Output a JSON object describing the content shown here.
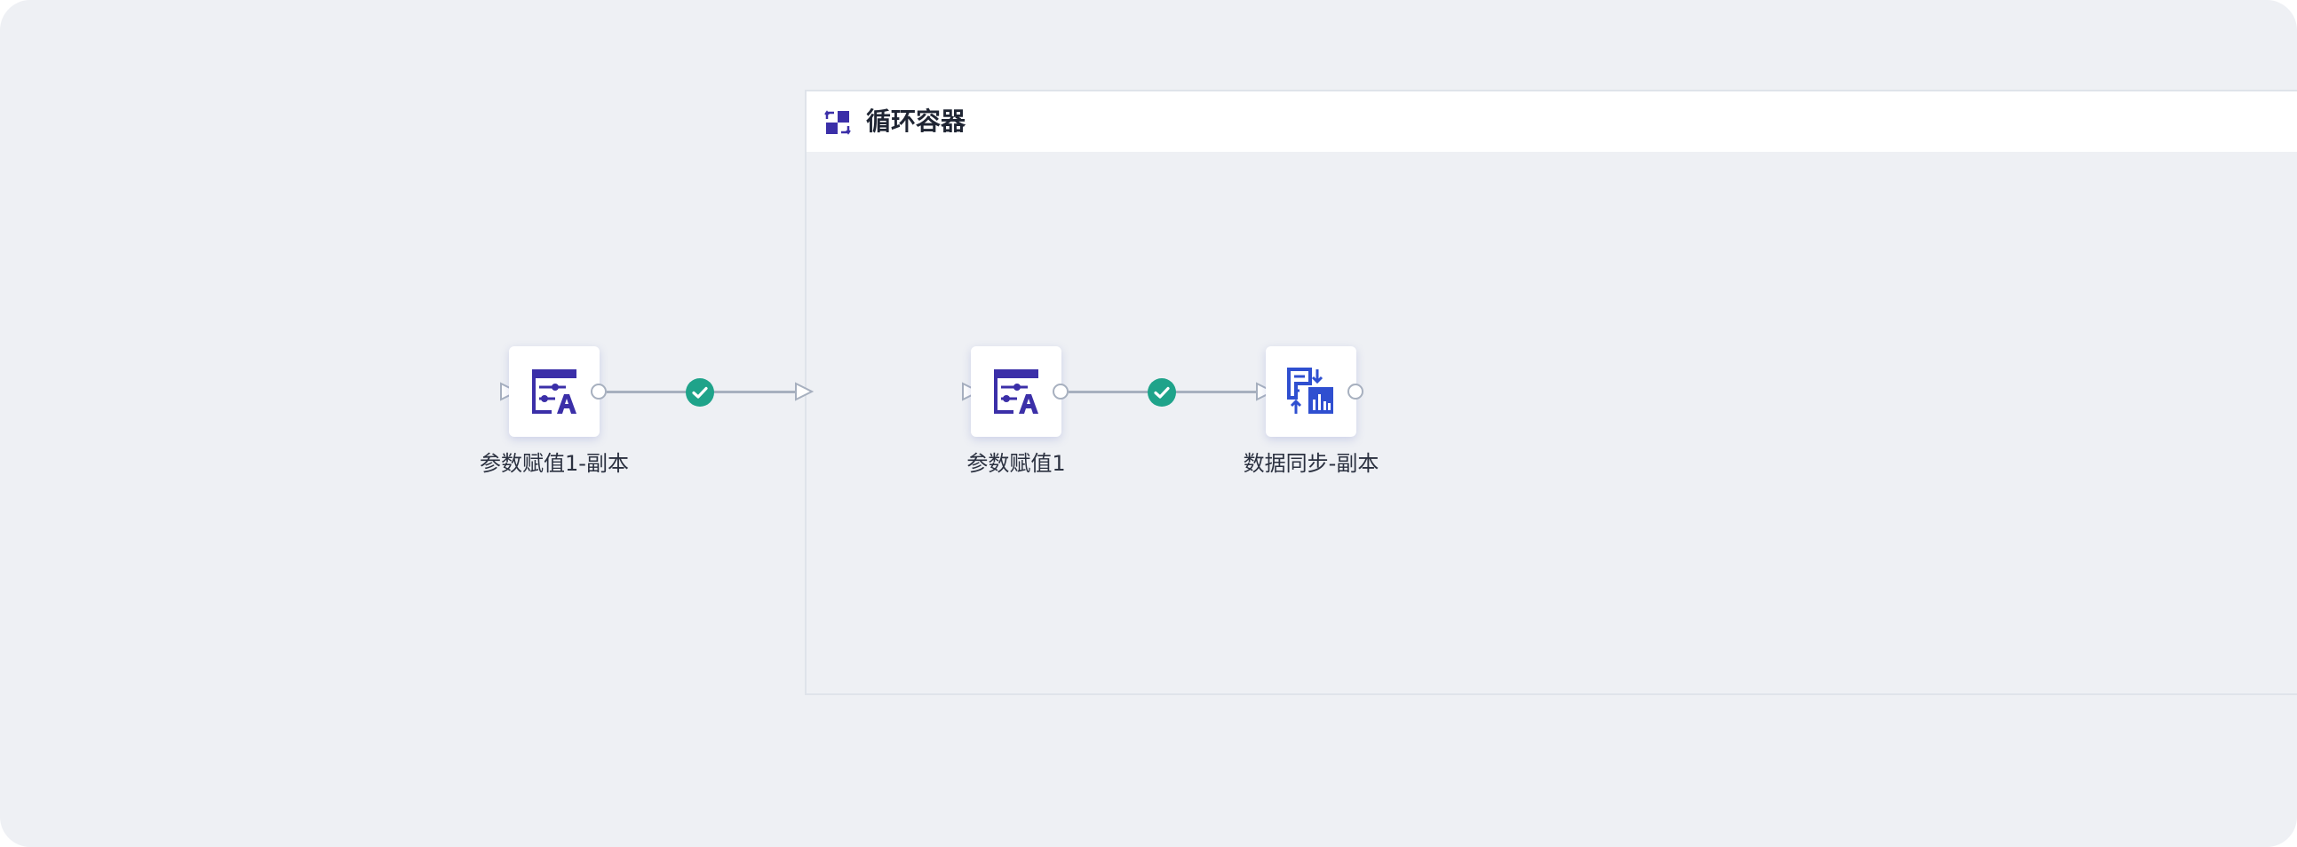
{
  "container": {
    "title": "循环容器",
    "icon": "loop-container-icon"
  },
  "nodes": [
    {
      "label": "参数赋值1-副本",
      "icon": "parameter-assign-icon"
    },
    {
      "label": "参数赋值1",
      "icon": "parameter-assign-icon"
    },
    {
      "label": "数据同步-副本",
      "icon": "data-sync-icon"
    }
  ],
  "edges": [
    {
      "from": "参数赋值1-副本",
      "to": "循环容器",
      "status": "success"
    },
    {
      "from": "参数赋值1",
      "to": "数据同步-副本",
      "status": "success"
    }
  ],
  "colors": {
    "background": "#eef0f4",
    "node_icon": "#3b2fa8",
    "sync_icon": "#2f4fd0",
    "success": "#1fa38a",
    "edge": "#a7b0bf"
  }
}
